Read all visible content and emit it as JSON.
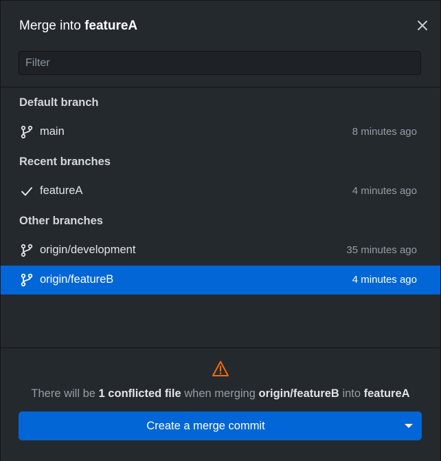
{
  "dialog": {
    "title_prefix": "Merge into",
    "current_branch": "featureA",
    "close_icon": "close-icon"
  },
  "filter": {
    "placeholder": "Filter",
    "value": ""
  },
  "groups": [
    {
      "header": "Default branch",
      "branches": [
        {
          "name": "main",
          "time": "8 minutes ago",
          "icon": "git-branch-icon"
        }
      ]
    },
    {
      "header": "Recent branches",
      "branches": [
        {
          "name": "featureA",
          "time": "4 minutes ago",
          "icon": "check-icon"
        }
      ]
    },
    {
      "header": "Other branches",
      "branches": [
        {
          "name": "origin/development",
          "time": "35 minutes ago",
          "icon": "git-branch-icon"
        },
        {
          "name": "origin/featureB",
          "time": "4 minutes ago",
          "icon": "git-branch-icon",
          "selected": true
        }
      ]
    }
  ],
  "footer": {
    "warning_icon": "warning-icon",
    "message": {
      "part1": "There will be",
      "conflicts": "1 conflicted file",
      "part2": "when merging",
      "source": "origin/featureB",
      "part3": "into",
      "target": "featureA"
    },
    "merge_button": {
      "label": "Create a merge commit",
      "dropdown_icon": "caret-down-icon"
    }
  },
  "colors": {
    "background": "#24292e",
    "accent": "#0366d6",
    "warning": "#f66a0a",
    "muted_text": "#959da5"
  }
}
